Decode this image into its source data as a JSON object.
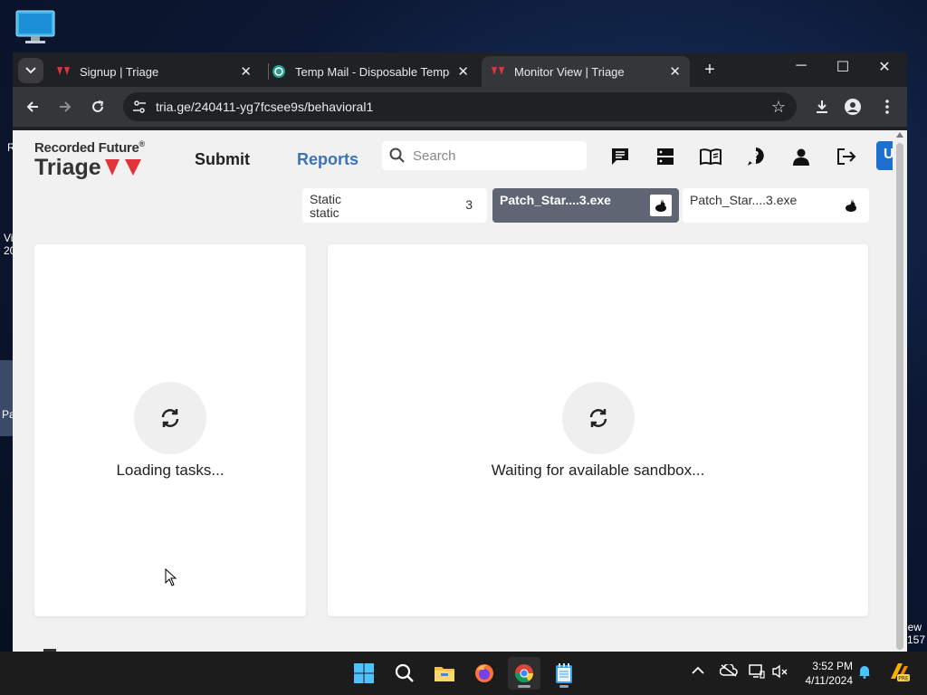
{
  "desktop": {
    "side_text_top": "R",
    "side_text_mid1": "Vi",
    "side_text_mid2": "20",
    "side_text_low": "Pa",
    "side_text_right1": "iew",
    "side_text_right2": "157"
  },
  "browser": {
    "tabs": [
      {
        "title": "Signup | Triage",
        "active": false
      },
      {
        "title": "Temp Mail - Disposable Tempor",
        "active": false
      },
      {
        "title": "Monitor View | Triage",
        "active": true
      }
    ],
    "url": "tria.ge/240411-yg7fcsee9s/behavioral1"
  },
  "page": {
    "logo_top": "Recorded Future",
    "logo_reg": "®",
    "logo_bottom": "Triage",
    "nav": {
      "submit": "Submit",
      "reports": "Reports"
    },
    "search_placeholder": "Search",
    "upgrade_label": "U",
    "task_tabs": {
      "static_line1": "Static",
      "static_line2": "static",
      "static_count": "3",
      "tab2_label": "Patch_Star....3.exe",
      "tab3_label": "Patch_Star....3.exe"
    },
    "left_panel_msg": "Loading tasks...",
    "right_panel_msg": "Waiting for available sandbox..."
  },
  "taskbar": {
    "time": "3:52 PM",
    "date": "4/11/2024"
  },
  "colors": {
    "reports_blue": "#3a73b8",
    "triage_red": "#e0333a",
    "chrome_dark": "#202124"
  }
}
